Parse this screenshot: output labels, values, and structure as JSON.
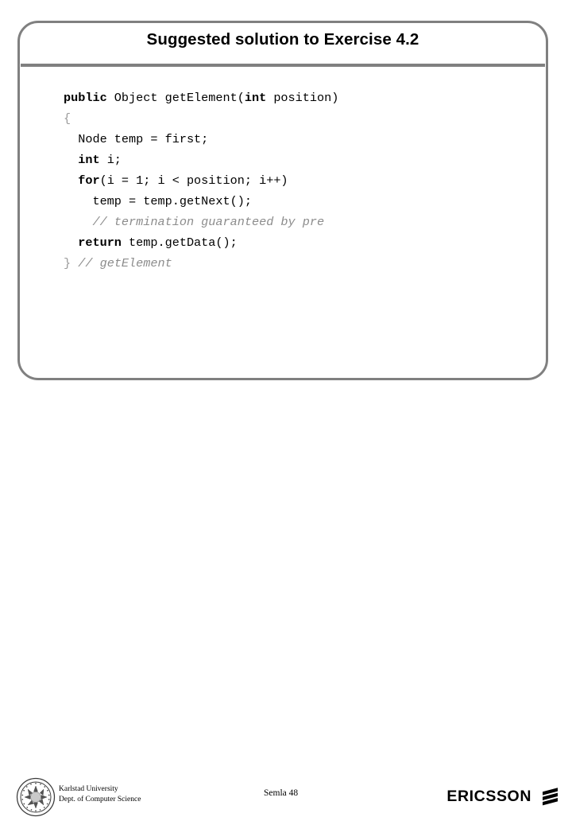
{
  "slide": {
    "title": "Suggested solution to Exercise 4.2",
    "accent_color": "#808080",
    "text_color": "#000000",
    "comment_color": "#8c8c8c",
    "background": "#ffffff"
  },
  "code": {
    "language": "java",
    "lines": [
      [
        {
          "t": "public",
          "s": "kw"
        },
        {
          "t": " Object getElement(",
          "s": "plain"
        },
        {
          "t": "int",
          "s": "kw"
        },
        {
          "t": " position)",
          "s": "plain"
        }
      ],
      [
        {
          "t": "{",
          "s": "punct"
        }
      ],
      [
        {
          "t": "  Node temp = first;",
          "s": "plain"
        }
      ],
      [
        {
          "t": "  ",
          "s": "plain"
        },
        {
          "t": "int",
          "s": "kw"
        },
        {
          "t": " i;",
          "s": "plain"
        }
      ],
      [
        {
          "t": "  ",
          "s": "plain"
        },
        {
          "t": "for",
          "s": "kw"
        },
        {
          "t": "(i = 1; i < position; i++)",
          "s": "plain"
        }
      ],
      [
        {
          "t": "    temp = temp.getNext();",
          "s": "plain"
        }
      ],
      [
        {
          "t": "    ",
          "s": "plain"
        },
        {
          "t": "// termination guaranteed by pre",
          "s": "comment"
        }
      ],
      [
        {
          "t": "  ",
          "s": "plain"
        },
        {
          "t": "return",
          "s": "kw"
        },
        {
          "t": " temp.getData();",
          "s": "plain"
        }
      ],
      [
        {
          "t": "}",
          "s": "punct"
        },
        {
          "t": " ",
          "s": "plain"
        },
        {
          "t": "// getElement",
          "s": "comment"
        }
      ]
    ]
  },
  "footer": {
    "university_line1": "Karlstad University",
    "university_line2": "Dept. of Computer Science",
    "university_seal_text": "KARLSTAD UNIVERSITY",
    "page_label": "Semla 48",
    "brand_name": "ERICSSON"
  }
}
